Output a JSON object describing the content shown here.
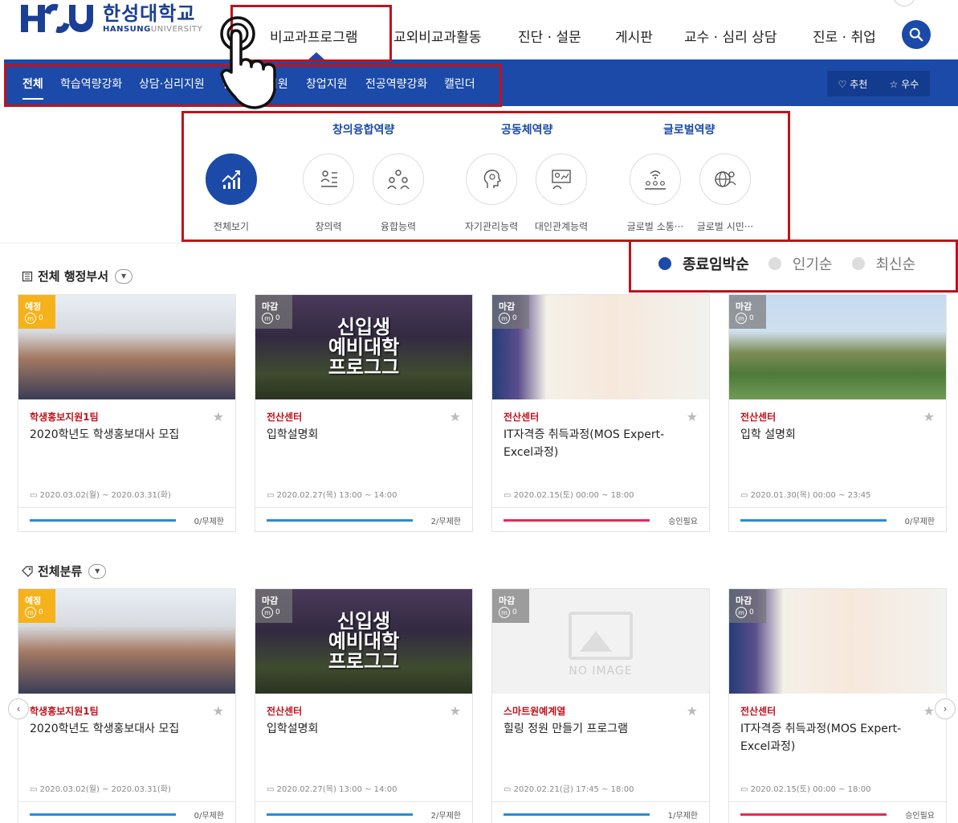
{
  "header": {
    "logo_ko": "한성대학교",
    "logo_en_bold": "HANSUNG",
    "logo_en_rest": "UNIVERSITY",
    "menu": [
      "비교과프로그램",
      "교외비교과활동",
      "진단 · 설문",
      "게시판",
      "교수 · 심리 상담",
      "진로 · 취업"
    ]
  },
  "subnav": {
    "tabs": [
      "전체",
      "학습역량강화",
      "상담·심리지원",
      "진로·취업지원",
      "창업지원",
      "전공역량강화",
      "캘린더"
    ],
    "recommend": "♡ 추천",
    "excellent": "☆ 우수"
  },
  "competency": {
    "groups": [
      "창의융합역량",
      "공동체역량",
      "글로벌역량"
    ],
    "items": [
      "전체보기",
      "창의력",
      "융합능력",
      "자기관리능력",
      "대인관계능력",
      "글로벌 소통···",
      "글로벌 시민···"
    ]
  },
  "sort": [
    "종료임박순",
    "인기순",
    "최신순"
  ],
  "sections": [
    "전체 행정부서",
    "전체분류"
  ],
  "colors": {
    "primary": "#1b4aa8",
    "accent_red": "#c0121b",
    "badge_yellow": "#f5b21a",
    "bar_blue": "#2b8bd6",
    "bar_pink": "#e5295a"
  },
  "cards1": [
    {
      "badge": "예정",
      "count_tag": "0",
      "dept": "학생홍보지원1팀",
      "title": "2020학년도 학생홍보대사 모집",
      "date": "2020.03.02(월) ~ 2020.03.31(화)",
      "capacity": "0/무제한"
    },
    {
      "badge": "마감",
      "count_tag": "0",
      "dept": "전산센터",
      "title": "입학설명회",
      "date": "2020.02.27(목) 13:00 ~ 14:00",
      "capacity": "2/무제한",
      "poster": "신입생\n예비대학\n프로그그"
    },
    {
      "badge": "마감",
      "count_tag": "0",
      "dept": "전산센터",
      "title": "IT자격증 취득과정(MOS Expert-Excel과정)",
      "date": "2020.02.15(토) 00:00 ~ 18:00",
      "capacity": "승인필요"
    },
    {
      "badge": "마감",
      "count_tag": "0",
      "dept": "전산센터",
      "title": "입학 설명회",
      "date": "2020.01.30(목) 00:00 ~ 23:45",
      "capacity": "0/무제한"
    }
  ],
  "cards2": [
    {
      "badge": "예정",
      "count_tag": "0",
      "dept": "학생홍보지원1팀",
      "title": "2020학년도 학생홍보대사 모집",
      "date": "2020.03.02(월) ~ 2020.03.31(화)",
      "capacity": "0/무제한"
    },
    {
      "badge": "마감",
      "count_tag": "0",
      "dept": "전산센터",
      "title": "입학설명회",
      "date": "2020.02.27(목) 13:00 ~ 14:00",
      "capacity": "2/무제한",
      "poster": "신입생\n예비대학\n프로그그"
    },
    {
      "badge": "마감",
      "count_tag": "0",
      "dept": "스마트원예계열",
      "title": "힐링 정원 만들기 프로그램",
      "date": "2020.02.21(금) 17:45 ~ 18:00",
      "capacity": "1/무제한",
      "noimage": "NO IMAGE"
    },
    {
      "badge": "마감",
      "count_tag": "0",
      "dept": "전산센터",
      "title": "IT자격증 취득과정(MOS Expert-Excel과정)",
      "date": "2020.02.15(토) 00:00 ~ 18:00",
      "capacity": "승인필요"
    }
  ]
}
